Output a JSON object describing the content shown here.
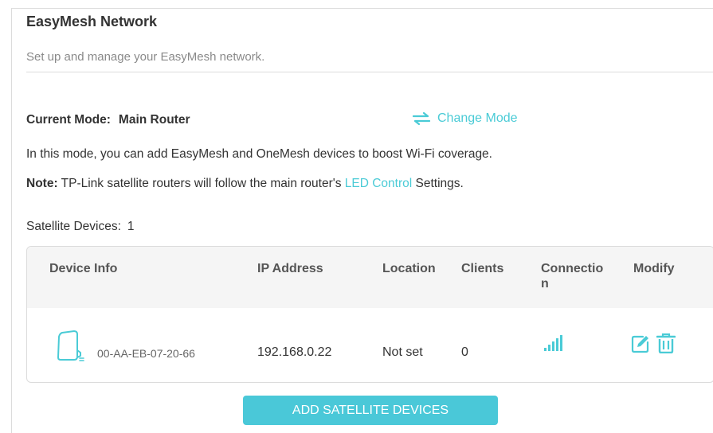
{
  "page": {
    "title": "EasyMesh Network",
    "subtitle": "Set up and manage your EasyMesh network."
  },
  "mode": {
    "label": "Current Mode:",
    "value": "Main Router",
    "change_label": "Change Mode",
    "change_icon": "swap-arrows-icon"
  },
  "info": {
    "line1": "In this mode, you can add EasyMesh and OneMesh devices to boost Wi-Fi coverage.",
    "note_label": "Note:",
    "note_text_before": " TP-Link satellite routers will follow the main router's ",
    "note_link": "LED Control",
    "note_text_after": " Settings."
  },
  "satellite": {
    "label": "Satellite Devices:",
    "count": "1"
  },
  "table": {
    "headers": {
      "device_info": "Device Info",
      "ip": "IP Address",
      "location": "Location",
      "clients": "Clients",
      "connection_1": "Connectio",
      "connection_2": "n",
      "modify": "Modify"
    },
    "rows": [
      {
        "device_icon": "satellite-device-icon",
        "mac": "00-AA-EB-07-20-66",
        "ip": "192.168.0.22",
        "location": "Not set",
        "clients": "0",
        "connection_icon": "signal-bars-icon",
        "signal_level_bars": 5
      }
    ]
  },
  "actions": {
    "add_button": "ADD SATELLITE DEVICES"
  },
  "colors": {
    "accent": "#4acbd6",
    "button": "#4ac8d8",
    "header_bg": "#f5f5f5",
    "text": "#333333",
    "muted": "#8a8a8a"
  }
}
